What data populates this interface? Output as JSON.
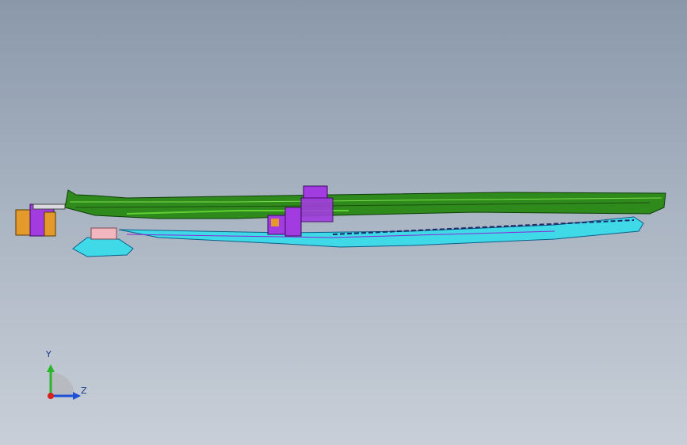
{
  "viewport": {
    "background_top": "#8a98aa",
    "background_bottom": "#c8cfd8"
  },
  "model": {
    "description_colors": {
      "green_body": "#2f8a1c",
      "purple_parts": "#a23ce0",
      "cyan_rail": "#3fd9e8",
      "orange_bracket": "#e39a2a",
      "pink_block": "#f2b7bf"
    }
  },
  "triad": {
    "y_label": "Y",
    "z_label": "Z",
    "y_color": "#2ab52a",
    "z_color": "#1f4fd6",
    "x_color": "#d62020"
  }
}
